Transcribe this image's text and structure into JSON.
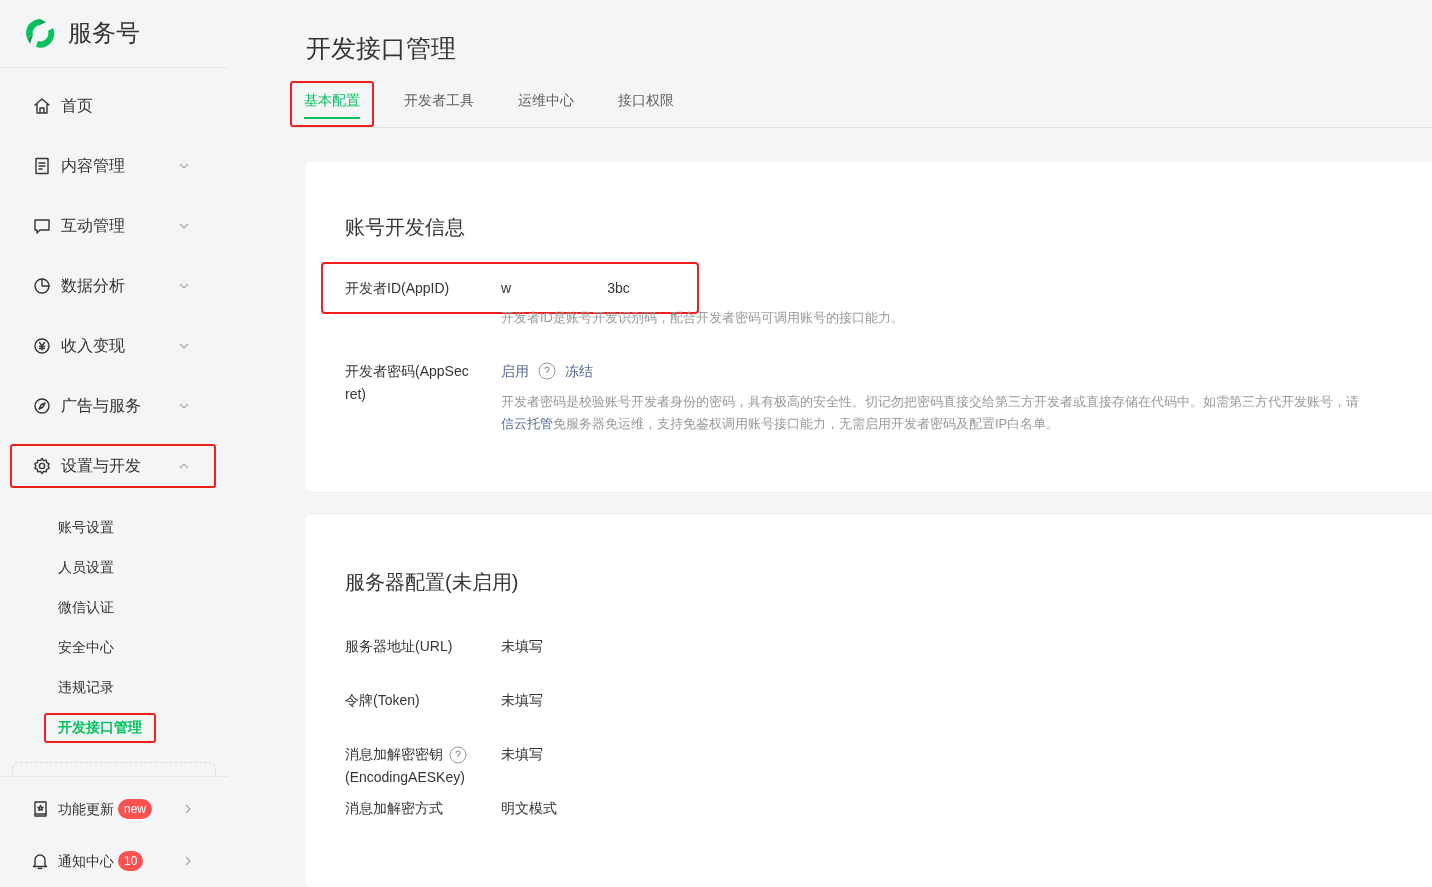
{
  "brand": {
    "name": "服务号"
  },
  "nav": [
    {
      "label": "首页",
      "kind": "link",
      "annotated": false
    },
    {
      "label": "内容管理",
      "kind": "group",
      "expanded": false,
      "annotated": false
    },
    {
      "label": "互动管理",
      "kind": "group",
      "expanded": false,
      "annotated": false
    },
    {
      "label": "数据分析",
      "kind": "group",
      "expanded": false,
      "annotated": false
    },
    {
      "label": "收入变现",
      "kind": "group",
      "expanded": false,
      "annotated": false
    },
    {
      "label": "广告与服务",
      "kind": "group",
      "expanded": false,
      "annotated": false
    },
    {
      "label": "设置与开发",
      "kind": "group",
      "expanded": true,
      "annotated": true,
      "children": [
        {
          "label": "账号设置",
          "selected": false,
          "annotated": false
        },
        {
          "label": "人员设置",
          "selected": false,
          "annotated": false
        },
        {
          "label": "微信认证",
          "selected": false,
          "annotated": false
        },
        {
          "label": "安全中心",
          "selected": false,
          "annotated": false
        },
        {
          "label": "违规记录",
          "selected": false,
          "annotated": false
        },
        {
          "label": "开发接口管理",
          "selected": true,
          "annotated": true
        }
      ]
    }
  ],
  "footer": [
    {
      "label": "功能更新",
      "badge": "new"
    },
    {
      "label": "通知中心",
      "badge": "10"
    }
  ],
  "page": {
    "title": "开发接口管理"
  },
  "tabs": [
    {
      "label": "基本配置",
      "selected": true,
      "annotated": true
    },
    {
      "label": "开发者工具",
      "selected": false,
      "annotated": false
    },
    {
      "label": "运维中心",
      "selected": false,
      "annotated": false
    },
    {
      "label": "接口权限",
      "selected": false,
      "annotated": false
    }
  ],
  "account_card": {
    "title": "账号开发信息",
    "appid": {
      "label": "开发者ID(AppID)",
      "value_start": "w",
      "value_end": "3bc",
      "hint": "开发者ID是账号开发识别码，配合开发者密码可调用账号的接口能力。",
      "annotated": true
    },
    "secret": {
      "label": "开发者密码(AppSecret)",
      "actions": [
        "启用",
        "冻结"
      ],
      "description": "开发者密码是校验账号开发者身份的密码，具有极高的安全性。切记勿把密码直接交给第三方开发者或直接存储在代码中。如需第三方代开发账号，请",
      "link": "信云托管",
      "description_rest": "免服务器免运维，支持免鉴权调用账号接口能力，无需启用开发者密码及配置IP白名单。"
    }
  },
  "server_card": {
    "title": "服务器配置(未启用)",
    "rows": [
      {
        "label": "服务器地址(URL)",
        "value": "未填写",
        "help": false
      },
      {
        "label": "令牌(Token)",
        "value": "未填写",
        "help": false
      },
      {
        "label": "消息加解密密钥",
        "label_note": "(EncodingAESKey)",
        "value": "未填写",
        "help": true
      },
      {
        "label": "消息加解密方式",
        "value": "明文模式",
        "help": false
      }
    ]
  }
}
